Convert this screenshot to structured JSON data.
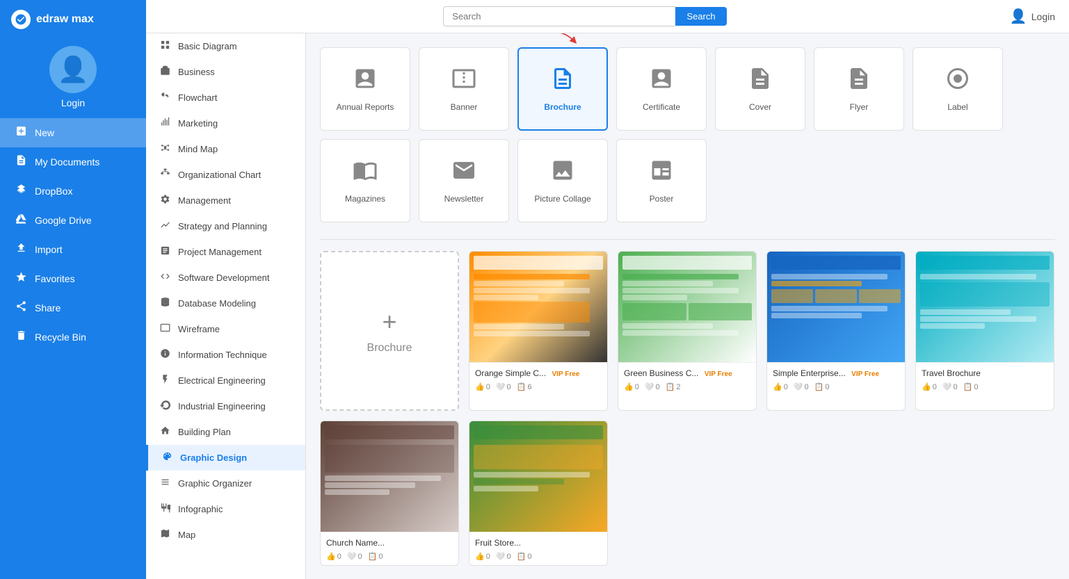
{
  "app": {
    "name": "edraw max",
    "logo_letter": "D"
  },
  "user": {
    "login_label": "Login"
  },
  "topbar": {
    "search_placeholder": "Search",
    "search_button": "Search",
    "login_label": "Login"
  },
  "sidebar": {
    "items": [
      {
        "id": "new",
        "label": "New",
        "icon": "➕",
        "active": true
      },
      {
        "id": "my-documents",
        "label": "My Documents",
        "icon": "📄",
        "active": false
      },
      {
        "id": "dropbox",
        "label": "DropBox",
        "icon": "⚙️",
        "active": false
      },
      {
        "id": "google-drive",
        "label": "Google Drive",
        "icon": "▲",
        "active": false
      },
      {
        "id": "import",
        "label": "Import",
        "icon": "⬇️",
        "active": false
      },
      {
        "id": "favorites",
        "label": "Favorites",
        "icon": "★",
        "active": false
      },
      {
        "id": "share",
        "label": "Share",
        "icon": "↗",
        "active": false
      },
      {
        "id": "recycle-bin",
        "label": "Recycle Bin",
        "icon": "🗑",
        "active": false
      }
    ]
  },
  "secondary_sidebar": {
    "items": [
      {
        "id": "basic-diagram",
        "label": "Basic Diagram",
        "icon": "⬜"
      },
      {
        "id": "business",
        "label": "Business",
        "icon": "💼"
      },
      {
        "id": "flowchart",
        "label": "Flowchart",
        "icon": "⬡"
      },
      {
        "id": "marketing",
        "label": "Marketing",
        "icon": "📊"
      },
      {
        "id": "mind-map",
        "label": "Mind Map",
        "icon": "🧠"
      },
      {
        "id": "organizational-chart",
        "label": "Organizational Chart",
        "icon": "🏢"
      },
      {
        "id": "management",
        "label": "Management",
        "icon": "⚙️"
      },
      {
        "id": "strategy-and-planning",
        "label": "Strategy and Planning",
        "icon": "📈"
      },
      {
        "id": "project-management",
        "label": "Project Management",
        "icon": "🗂"
      },
      {
        "id": "software-development",
        "label": "Software Development",
        "icon": "💻"
      },
      {
        "id": "database-modeling",
        "label": "Database Modeling",
        "icon": "🗃"
      },
      {
        "id": "wireframe",
        "label": "Wireframe",
        "icon": "🖥"
      },
      {
        "id": "information-technique",
        "label": "Information Technique",
        "icon": "ℹ"
      },
      {
        "id": "electrical-engineering",
        "label": "Electrical Engineering",
        "icon": "⚡"
      },
      {
        "id": "industrial-engineering",
        "label": "Industrial Engineering",
        "icon": "🔧"
      },
      {
        "id": "building-plan",
        "label": "Building Plan",
        "icon": "🏗"
      },
      {
        "id": "graphic-design",
        "label": "Graphic Design",
        "icon": "🎨",
        "active": true
      },
      {
        "id": "graphic-organizer",
        "label": "Graphic Organizer",
        "icon": "⬡"
      },
      {
        "id": "infographic",
        "label": "Infographic",
        "icon": "📋"
      },
      {
        "id": "map",
        "label": "Map",
        "icon": "🗺"
      }
    ]
  },
  "categories": [
    {
      "id": "annual-reports",
      "label": "Annual Reports",
      "icon": "📊"
    },
    {
      "id": "banner",
      "label": "Banner",
      "icon": "🖼"
    },
    {
      "id": "brochure",
      "label": "Brochure",
      "icon": "📰",
      "selected": true
    },
    {
      "id": "certificate",
      "label": "Certificate",
      "icon": "📜"
    },
    {
      "id": "cover",
      "label": "Cover",
      "icon": "📋"
    },
    {
      "id": "flyer",
      "label": "Flyer",
      "icon": "📄"
    },
    {
      "id": "label",
      "label": "Label",
      "icon": "🏷"
    },
    {
      "id": "magazines",
      "label": "Magazines",
      "icon": "📰"
    },
    {
      "id": "newsletter",
      "label": "Newsletter",
      "icon": "📰"
    },
    {
      "id": "picture-collage",
      "label": "Picture Collage",
      "icon": "🖼"
    },
    {
      "id": "poster",
      "label": "Poster",
      "icon": "📋"
    }
  ],
  "templates": {
    "new_label": "Brochure",
    "items": [
      {
        "id": "orange-simple",
        "title": "Orange Simple C...",
        "badge": "VIP Free",
        "color": "orange",
        "likes": "0",
        "hearts": "0",
        "copies": "6"
      },
      {
        "id": "green-business",
        "title": "Green Business C...",
        "badge": "VIP Free",
        "color": "green",
        "likes": "0",
        "hearts": "0",
        "copies": "2"
      },
      {
        "id": "simple-enterprise",
        "title": "Simple Enterprise...",
        "badge": "VIP Free",
        "color": "blue-gray",
        "likes": "0",
        "hearts": "0",
        "copies": "0"
      },
      {
        "id": "travel-brochure",
        "title": "Travel Brochure",
        "badge": "",
        "color": "travel",
        "likes": "0",
        "hearts": "0",
        "copies": "0"
      },
      {
        "id": "church-brochure",
        "title": "Church Name...",
        "badge": "",
        "color": "church",
        "likes": "0",
        "hearts": "0",
        "copies": "0"
      },
      {
        "id": "food-brochure",
        "title": "Fruit Store...",
        "badge": "",
        "color": "food",
        "likes": "0",
        "hearts": "0",
        "copies": "0"
      }
    ]
  }
}
